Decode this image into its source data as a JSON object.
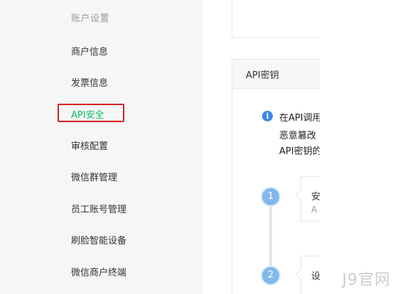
{
  "sidebar": {
    "section_title": "账户设置",
    "items": [
      {
        "label": "商户信息"
      },
      {
        "label": "发票信息"
      },
      {
        "label": "API安全",
        "active": true
      },
      {
        "label": "审核配置"
      },
      {
        "label": "微信群管理"
      },
      {
        "label": "员工账号管理"
      },
      {
        "label": "刷脸智能设备"
      },
      {
        "label": "微信商户终端"
      }
    ]
  },
  "main": {
    "api_card": {
      "title": "API密钥",
      "info_lines": [
        "在API调用",
        "恶意篡改",
        "API密钥的"
      ]
    },
    "steps": [
      {
        "number": "1",
        "title": "安",
        "subtitle": "A"
      },
      {
        "number": "2",
        "title": "设"
      }
    ]
  },
  "watermark": "J9官网",
  "colors": {
    "sidebar_bg": "#f6f6f6",
    "active": "#07c160",
    "highlight": "#d42222",
    "info_icon": "#3a86e8",
    "step_circle": "#82b8ea"
  }
}
